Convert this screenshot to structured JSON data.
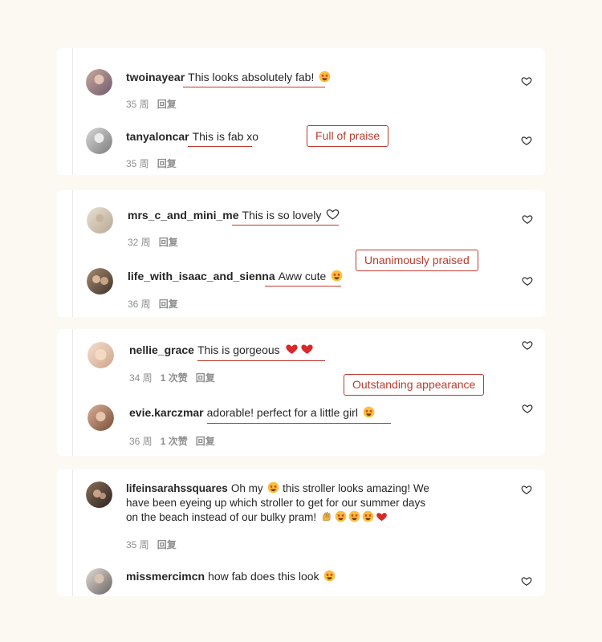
{
  "colors": {
    "background": "#fcf9f3",
    "card": "#ffffff",
    "accent_red": "#c0392b",
    "meta_gray": "#8e8e8e"
  },
  "groups": [
    {
      "tag": "Full of praise",
      "comments": [
        {
          "user": "twoinayear",
          "text": "This looks absolutely fab!",
          "emojis": [
            "star-struck-emoji"
          ],
          "time": "35 周",
          "likes": "",
          "reply": "回复"
        },
        {
          "user": "tanyaloncar",
          "text": "This is fab xo",
          "emojis": [],
          "time": "35 周",
          "likes": "",
          "reply": "回复"
        }
      ]
    },
    {
      "tag": "Unanimously praised",
      "comments": [
        {
          "user": "mrs_c_and_mini_me",
          "text": "This is so lovely",
          "emojis": [
            "white-heart-emoji"
          ],
          "time": "32 周",
          "likes": "",
          "reply": "回复"
        },
        {
          "user": "life_with_isaac_and_sienna",
          "text": "Aww cute",
          "emojis": [
            "star-struck-emoji"
          ],
          "time": "36 周",
          "likes": "",
          "reply": "回复"
        }
      ]
    },
    {
      "tag": "Outstanding appearance",
      "comments": [
        {
          "user": "nellie_grace",
          "text": "This is gorgeous",
          "emojis": [
            "red-heart-emoji",
            "red-heart-emoji"
          ],
          "time": "34 周",
          "likes": "1 次赞",
          "reply": "回复"
        },
        {
          "user": "evie.karczmar",
          "text": "adorable! perfect for a little girl",
          "emojis": [
            "star-struck-emoji"
          ],
          "time": "36 周",
          "likes": "1 次赞",
          "reply": "回复"
        }
      ]
    },
    {
      "comments": [
        {
          "user": "lifeinsarahssquares",
          "text_a": "Oh my",
          "text_b": "this stroller looks amazing! We have been eyeing up which stroller to get for our summer days on the beach instead of our bulky pram!",
          "emojis": [
            "star-struck-emoji",
            "raised-hands-emoji",
            "star-struck-emoji",
            "star-struck-emoji",
            "star-struck-emoji",
            "red-heart-emoji"
          ],
          "time": "35 周",
          "likes": "",
          "reply": "回复"
        },
        {
          "user": "missmercimcn",
          "text": "how fab does this look",
          "emojis": [
            "star-struck-emoji"
          ],
          "time": "",
          "likes": "",
          "reply": ""
        }
      ]
    }
  ]
}
